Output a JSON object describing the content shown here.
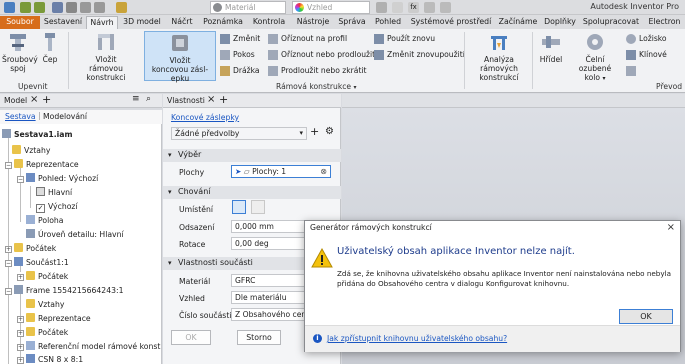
{
  "titlebar": {
    "material_placeholder": "Materiál",
    "appearance_placeholder": "Vzhled",
    "app_title": "Autodesk Inventor Pro"
  },
  "tabs": [
    "Soubor",
    "Sestavení",
    "Návrh",
    "3D model",
    "Náčrt",
    "Poznámka",
    "Kontrola",
    "Nástroje",
    "Správa",
    "Pohled",
    "Systémové prostředí",
    "Začínáme",
    "Doplňky",
    "Spolupracovat",
    "Electron"
  ],
  "ribbon": {
    "srouby": "Šroubový spoj",
    "cep": "Čep",
    "upevnit": "Upevnit",
    "vlozit_ramovou": [
      "Vložit",
      "rámovou konstrukci"
    ],
    "vlozit_koncovou": [
      "Vložit",
      "koncovou zásl­epku"
    ],
    "zmenit": "Změnit",
    "pokos": "Pokos",
    "drazka": "Drážka",
    "oriznout_profil": "Oříznout na profil",
    "oriznout_prodlouzit": "Oříznout nebo prodloužit",
    "prodlouzit_zkratit": "Prodloužit nebo zkrátit",
    "pouzit_znovu": "Použít znovu",
    "zmenit_nainstal": "Změnit znovupoužití",
    "ramova_konstrukce": "Rámová konstrukce",
    "analyza": [
      "Analýza",
      "rámových konstrukcí"
    ],
    "hridel": "Hřídel",
    "celni_kolo": [
      "Čelní",
      "ozubené kolo"
    ],
    "loziska": "Ložisko",
    "klinove": "Klínové",
    "prevod": "Převod"
  },
  "model_browser": {
    "title": "Model",
    "tab_sestava": "Sestava",
    "tab_modelovani": "Modelování",
    "tree": [
      {
        "label": "Sestava1.iam",
        "bold": true
      },
      {
        "label": "Vztahy"
      },
      {
        "label": "Reprezentace"
      },
      {
        "label": "Pohled: Výchozí"
      },
      {
        "label": "Hlavní"
      },
      {
        "label": "Výchozí"
      },
      {
        "label": "Poloha"
      },
      {
        "label": "Úroveň detailu: Hlavní"
      },
      {
        "label": "Počátek"
      },
      {
        "label": "Součást1:1"
      },
      {
        "label": "Počátek"
      },
      {
        "label": "Frame 1554215664243:1"
      },
      {
        "label": "Vztahy"
      },
      {
        "label": "Reprezentace"
      },
      {
        "label": "Počátek"
      },
      {
        "label": "Referenční model rámové konstrukce"
      },
      {
        "label": "CSN 8 x 8:1"
      }
    ]
  },
  "properties": {
    "title": "Vlastnosti",
    "link_title": "Koncové záslepky",
    "preset": "Žádné předvolby",
    "sec_vyber": "Výběr",
    "plochy_label": "Plochy",
    "plochy_value": "Plochy: 1",
    "sec_chovani": "Chování",
    "umisteni_label": "Umístění",
    "odsazeni_label": "Odsazení",
    "odsazeni_value": "0,000 mm",
    "rotace_label": "Rotace",
    "rotace_value": "0,00 deg",
    "sec_vlastnosti": "Vlastnosti součásti",
    "material_label": "Materiál",
    "material_value": "GFRC",
    "vzhled_label": "Vzhled",
    "vzhled_value": "Dle materiálu",
    "cislo_label": "Číslo součásti",
    "cislo_value": "Z Obsahového centra",
    "ok": "OK",
    "storno": "Storno"
  },
  "dialog": {
    "title": "Generátor rámových konstrukcí",
    "main": "Uživatelský obsah aplikace Inventor nelze najít.",
    "body": "Zdá se, že knihovna uživatelského obsahu aplikace Inventor není nainstalována nebo nebyla přidána do Obsahového centra v dialogu Konfigurovat knihovnu.",
    "ok": "OK",
    "help_link": "Jak zpřístupnit knihovnu uživatelského obsahu?"
  },
  "colors": {
    "file_tab": "#d76d1b",
    "accent_blue": "#1e3c8c",
    "link_blue": "#1a56c2",
    "warning_yellow": "#f4c20d"
  }
}
